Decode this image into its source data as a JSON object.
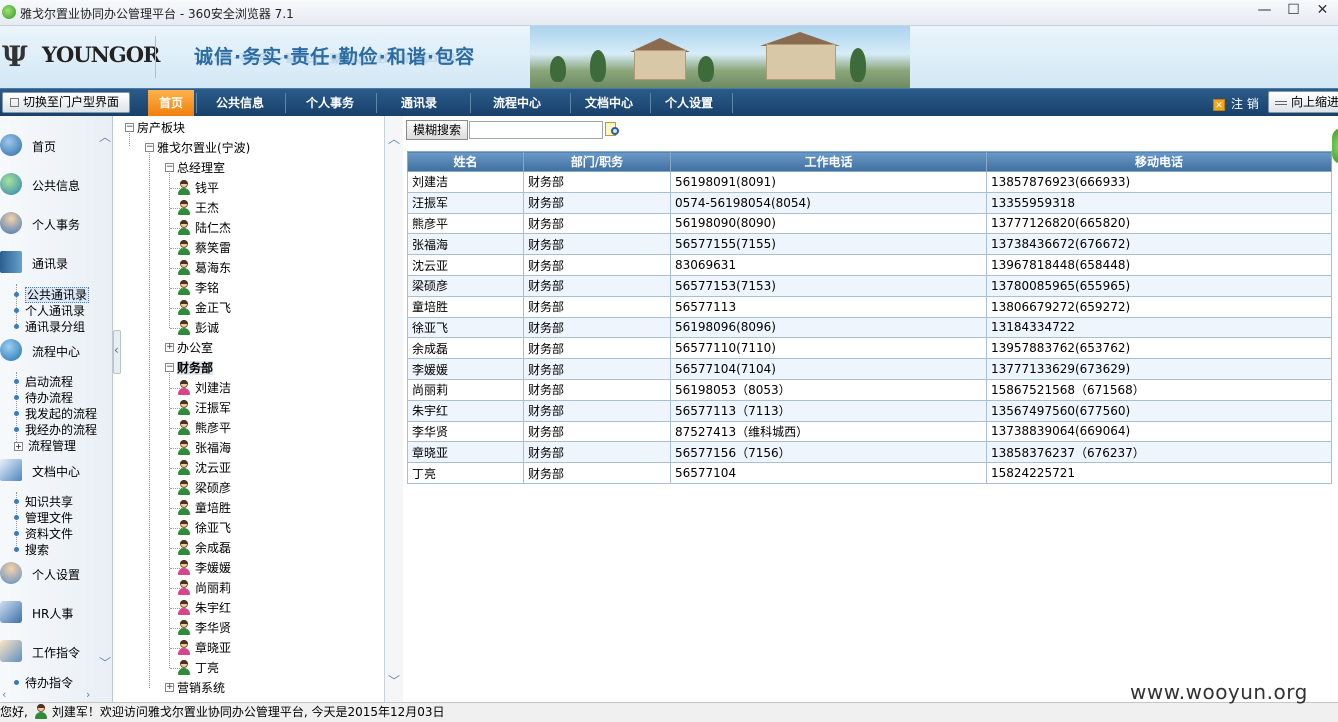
{
  "window": {
    "title": "雅戈尔置业协同办公管理平台 - 360安全浏览器 7.1",
    "min_label": "—",
    "max_label": "☐",
    "close_label": "✕"
  },
  "header": {
    "logo_mark": "Ψ",
    "logo_text": "YOUNGOR",
    "slogan": "诚信·务实·责任·勤俭·和谐·包容"
  },
  "menubar": {
    "switch_label": "切换至门户型界面",
    "items": [
      "首页",
      "公共信息",
      "个人事务",
      "通讯录",
      "流程中心",
      "文档中心",
      "个人设置"
    ],
    "active": "首页",
    "logout_icon": "✕",
    "logout_label": "注 销",
    "collapse_label": "向上缩进"
  },
  "leftnav": {
    "sections": [
      {
        "label": "首页",
        "icon": "home-icon"
      },
      {
        "label": "公共信息",
        "icon": "globe-icon"
      },
      {
        "label": "个人事务",
        "icon": "person-icon"
      },
      {
        "label": "通讯录",
        "icon": "book-icon"
      },
      {
        "label": "流程中心",
        "icon": "refresh-icon"
      },
      {
        "label": "文档中心",
        "icon": "document-icon"
      },
      {
        "label": "个人设置",
        "icon": "user-settings-icon"
      },
      {
        "label": "HR人事",
        "icon": "hr-icon"
      },
      {
        "label": "工作指令",
        "icon": "clipboard-icon"
      }
    ],
    "contacts_sub": [
      "公共通讯录",
      "个人通讯录",
      "通讯录分组"
    ],
    "workflow_sub": [
      "启动流程",
      "待办流程",
      "我发起的流程",
      "我经办的流程",
      "流程管理"
    ],
    "docs_sub": [
      "知识共享",
      "管理文件",
      "资料文件",
      "搜索"
    ],
    "work_sub": [
      "待办指令"
    ]
  },
  "tree": {
    "root": "房产板块",
    "company": "雅戈尔置业(宁波)",
    "dept_gm": "总经理室",
    "gm_members": [
      {
        "name": "钱平",
        "g": "m"
      },
      {
        "name": "王杰",
        "g": "m"
      },
      {
        "name": "陆仁杰",
        "g": "m"
      },
      {
        "name": "蔡笑雷",
        "g": "m"
      },
      {
        "name": "葛海东",
        "g": "m"
      },
      {
        "name": "李铭",
        "g": "m"
      },
      {
        "name": "金正飞",
        "g": "m"
      },
      {
        "name": "彭诚",
        "g": "m"
      }
    ],
    "dept_office": "办公室",
    "dept_finance": "财务部",
    "finance_members": [
      {
        "name": "刘建洁",
        "g": "f"
      },
      {
        "name": "汪振军",
        "g": "m"
      },
      {
        "name": "熊彦平",
        "g": "m"
      },
      {
        "name": "张福海",
        "g": "m"
      },
      {
        "name": "沈云亚",
        "g": "m"
      },
      {
        "name": "梁硕彦",
        "g": "m"
      },
      {
        "name": "童培胜",
        "g": "m"
      },
      {
        "name": "徐亚飞",
        "g": "m"
      },
      {
        "name": "余成磊",
        "g": "m"
      },
      {
        "name": "李媛媛",
        "g": "f"
      },
      {
        "name": "尚丽莉",
        "g": "f"
      },
      {
        "name": "朱宇红",
        "g": "f"
      },
      {
        "name": "李华贤",
        "g": "m"
      },
      {
        "name": "章晓亚",
        "g": "f"
      },
      {
        "name": "丁亮",
        "g": "m"
      }
    ],
    "dept_sales": "营销系统"
  },
  "content": {
    "search_button": "模糊搜索",
    "search_value": "",
    "columns": [
      "姓名",
      "部门/职务",
      "工作电话",
      "移动电话"
    ],
    "rows": [
      [
        "刘建洁",
        "财务部",
        "56198091(8091)",
        "13857876923(666933)"
      ],
      [
        "汪振军",
        "财务部",
        "0574-56198054(8054)",
        "13355959318"
      ],
      [
        "熊彦平",
        "财务部",
        "56198090(8090)",
        "13777126820(665820)"
      ],
      [
        "张福海",
        "财务部",
        "56577155(7155)",
        "13738436672(676672)"
      ],
      [
        "沈云亚",
        "财务部",
        "83069631",
        "13967818448(658448)"
      ],
      [
        "梁硕彦",
        "财务部",
        "56577153(7153)",
        "13780085965(655965)"
      ],
      [
        "童培胜",
        "财务部",
        "56577113",
        "13806679272(659272)"
      ],
      [
        "徐亚飞",
        "财务部",
        "56198096(8096)",
        "13184334722"
      ],
      [
        "余成磊",
        "财务部",
        "56577110(7110)",
        "13957883762(653762)"
      ],
      [
        "李媛媛",
        "财务部",
        "56577104(7104)",
        "13777133629(673629)"
      ],
      [
        "尚丽莉",
        "财务部",
        "56198053（8053）",
        "15867521568（671568）"
      ],
      [
        "朱宇红",
        "财务部",
        "56577113（7113）",
        "13567497560(677560)"
      ],
      [
        "李华贤",
        "财务部",
        "87527413（维科城西）",
        "13738839064(669064)"
      ],
      [
        "章晓亚",
        "财务部",
        "56577156（7156）",
        "13858376237（676237）"
      ],
      [
        "丁亮",
        "财务部",
        "56577104",
        "15824225721"
      ]
    ]
  },
  "status": {
    "prefix": "您好,",
    "message": "刘建军！欢迎访问雅戈尔置业协同办公管理平台, 今天是2015年12月03日"
  },
  "watermark": "www.wooyun.org",
  "colors": {
    "menu_active": "#f07f0c",
    "menu_bar": "#18416a",
    "grid_header": "#3f6f9f",
    "row_alt": "#eef5fc"
  }
}
